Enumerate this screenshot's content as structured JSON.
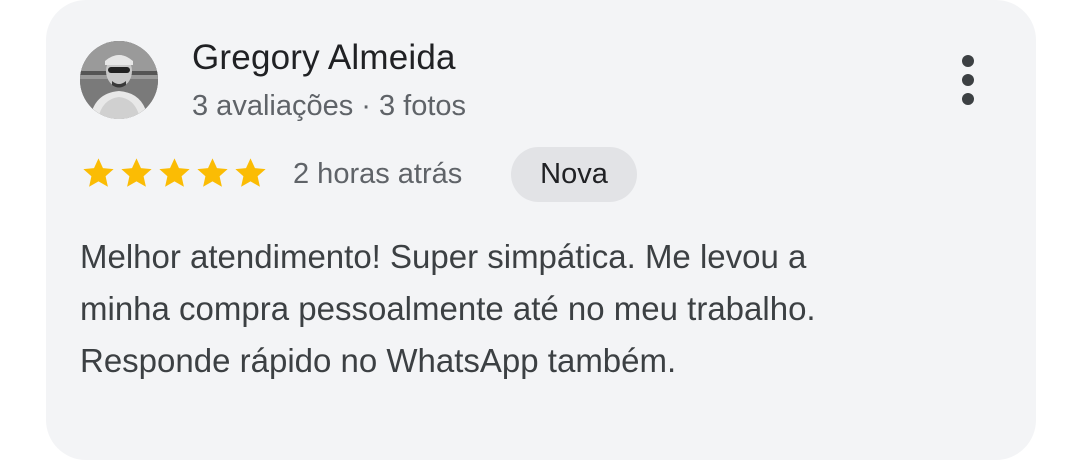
{
  "review": {
    "author_name": "Gregory Almeida",
    "author_meta": "3 avaliações · 3 fotos",
    "rating": 5,
    "rating_max": 5,
    "star_color": "#fbbc04",
    "time_ago": "2 horas atrás",
    "badge": "Nova",
    "text_lines": [
      "Melhor atendimento! Super simpática. Me levou a",
      "minha compra pessoalmente até no meu trabalho.",
      "Responde rápido no WhatsApp também."
    ],
    "icons": {
      "avatar": "user-avatar-photo",
      "menu": "more-vert-icon",
      "star": "star-icon"
    }
  }
}
